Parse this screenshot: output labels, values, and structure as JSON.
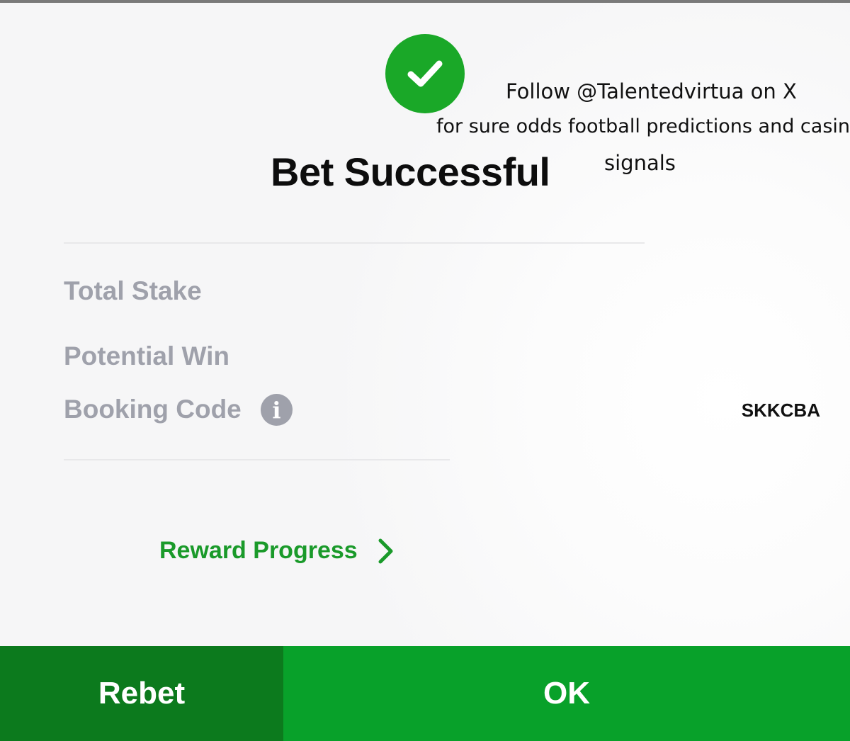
{
  "dialog": {
    "title": "Bet Successful",
    "rows": [
      {
        "label": "Total Stake",
        "value": ""
      },
      {
        "label": "Potential Win",
        "value": ""
      },
      {
        "label": "Booking Code",
        "value": "SKKCBA"
      }
    ],
    "info_icon_glyph": "i",
    "reward_link_label": "Reward Progress",
    "rebet_label": "Rebet",
    "ok_label": "OK"
  },
  "overlay": {
    "line1": "Follow @Talentedvirtua on X",
    "line2": "for sure odds football predictions and casino",
    "line3": "signals"
  },
  "colors": {
    "success_green": "#1aa828",
    "link_green": "#1a9a2a",
    "rebet_bg": "#0c7a1d",
    "ok_bg": "#08a12a",
    "muted_label": "#9fa1ab"
  },
  "icons": {
    "success": "checkmark-circle-icon",
    "info": "info-icon",
    "chevron": "chevron-right-icon"
  }
}
